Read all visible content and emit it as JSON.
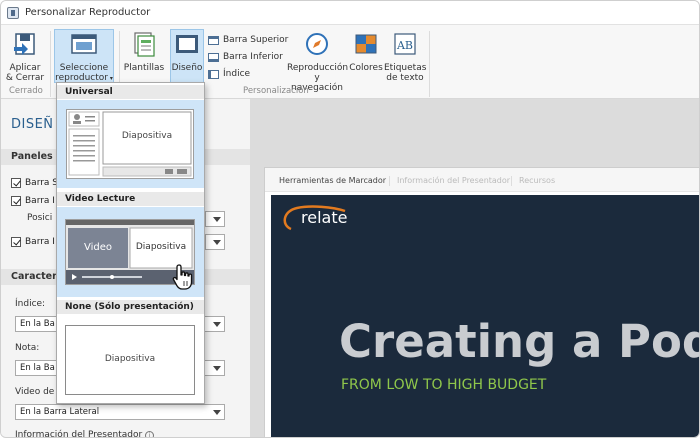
{
  "window": {
    "title": "Personalizar Reproductor"
  },
  "ribbon": {
    "buttons": {
      "apply_close": [
        "Aplicar",
        "& Cerrar"
      ],
      "select_player": [
        "Seleccione",
        "reproductor"
      ],
      "templates": "Plantillas",
      "design": "Diseño",
      "top_bar": "Barra Superior",
      "bottom_bar": "Barra Inferior",
      "index": "Índice",
      "playback": [
        "Reproducción",
        "y navegación"
      ],
      "colors": "Colores",
      "text_labels": [
        "Etiquetas",
        "de texto"
      ]
    },
    "groups": {
      "closed": "Cerrado",
      "personalization": "Personalización"
    }
  },
  "left_panel": {
    "heading": "DISEÑ",
    "panels_section": "Paneles d",
    "checkboxes": [
      "Barra S",
      "Barra I",
      "Barra I"
    ],
    "position_label": "Posici",
    "features_section": "Característ",
    "index_label": "Índice:",
    "index_value": "En la Ba",
    "note_label": "Nota:",
    "note_value": "En la Ba",
    "video_label": "Video de",
    "video_value": "En la Barra Lateral",
    "presenter_label": "Información del Presentador"
  },
  "dropdown": {
    "options": [
      {
        "header": "Universal",
        "slide_label": "Diapositiva"
      },
      {
        "header": "Video Lecture",
        "video_label": "Video",
        "slide_label": "Diapositiva"
      },
      {
        "header": "None (Sólo presentación)",
        "slide_label": "Diapositiva"
      }
    ]
  },
  "player": {
    "tabs": [
      "Herramientas de Marcador",
      "Información del Presentador",
      "Recursos"
    ],
    "slide": {
      "logo": "relate",
      "title": "Creating a Podc",
      "subtitle": "FROM LOW TO HIGH BUDGET"
    }
  },
  "colors": {
    "accent_blue": "#2a5f8e",
    "selected_bg": "#cfe5f8",
    "slide_bg": "#1b2a3c",
    "subtitle_green": "#8fc74b",
    "logo_orange": "#e27a1f"
  }
}
